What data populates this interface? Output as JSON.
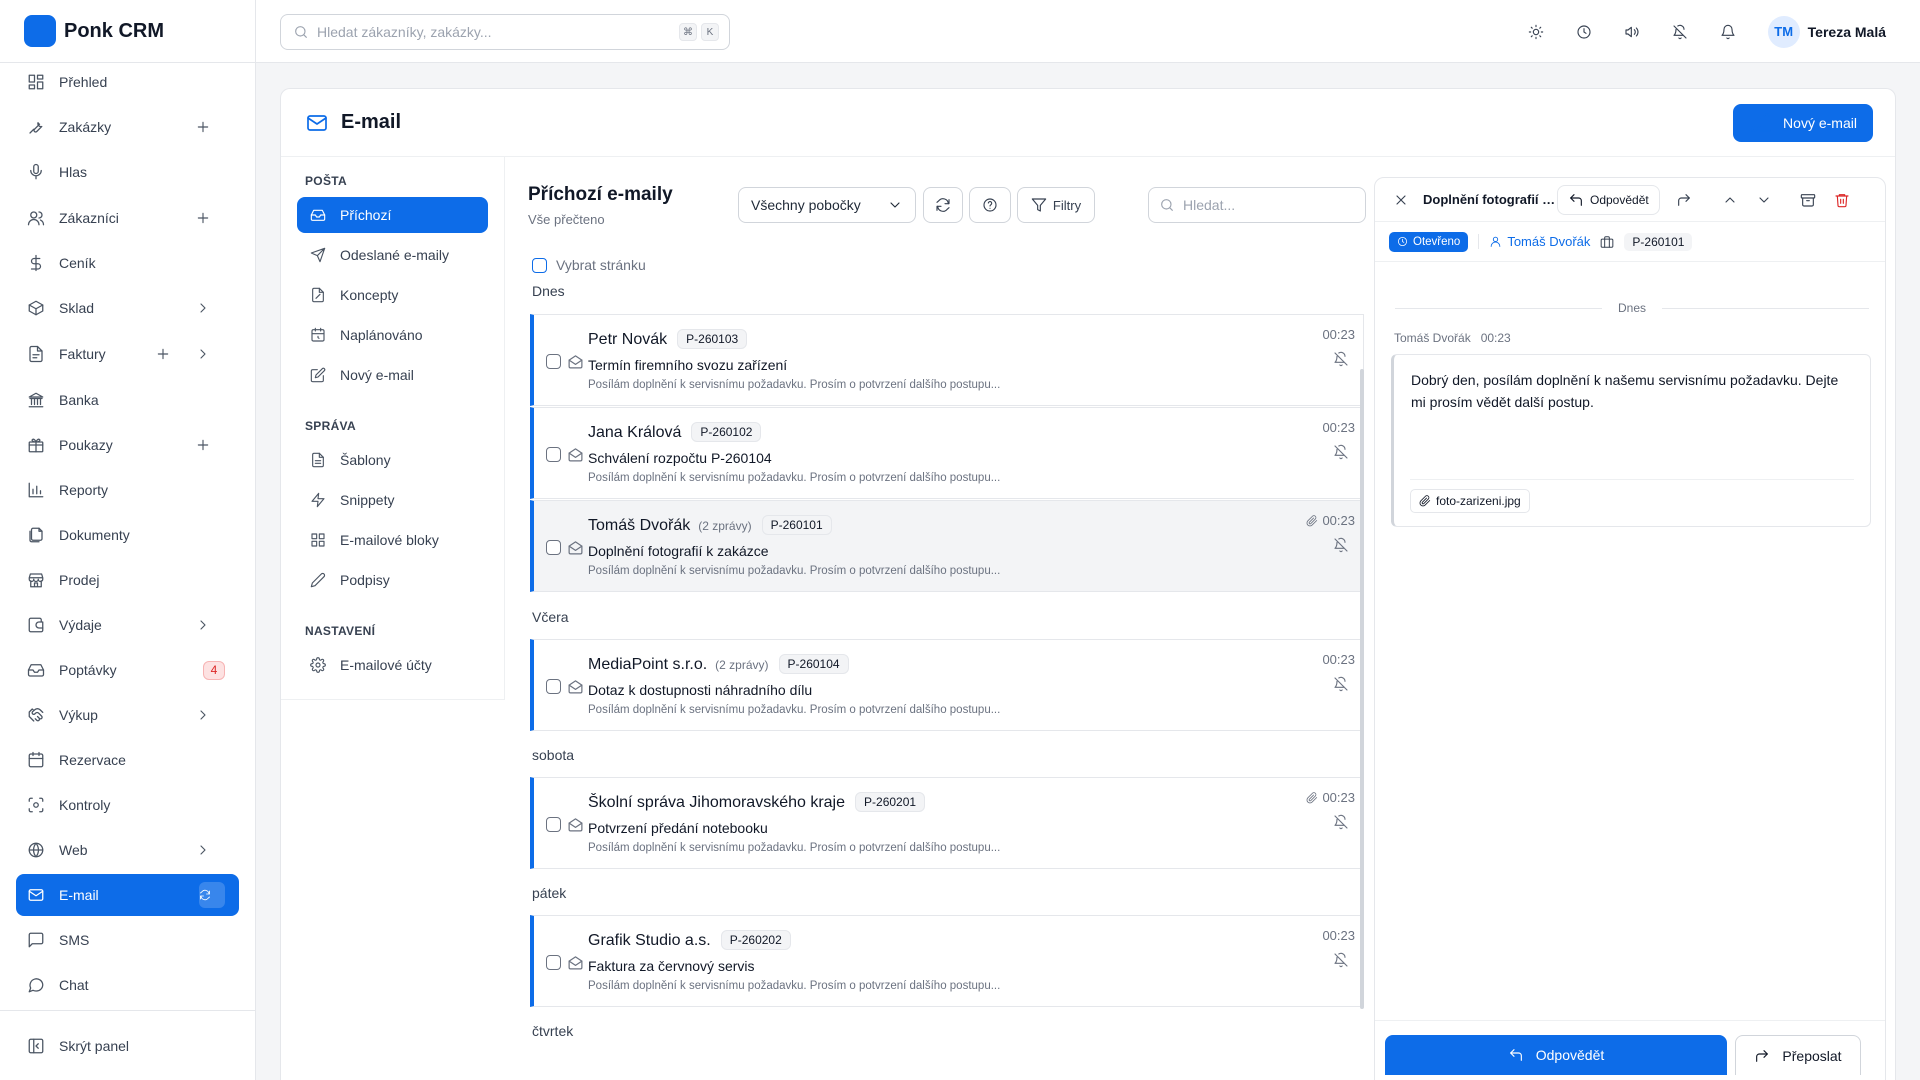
{
  "app": {
    "name": "Ponk CRM"
  },
  "sidebar": {
    "items": [
      {
        "label": "Přehled",
        "icon": "dashboard-icon"
      },
      {
        "label": "Zakázky",
        "icon": "wrench-icon",
        "plus": true
      },
      {
        "label": "Hlas",
        "icon": "microphone-icon"
      },
      {
        "label": "Zákazníci",
        "icon": "users-icon",
        "plus": true
      },
      {
        "label": "Ceník",
        "icon": "dollar-icon"
      },
      {
        "label": "Sklad",
        "icon": "box-icon",
        "chevron": true
      },
      {
        "label": "Faktury",
        "icon": "invoice-icon",
        "plus": true,
        "chevron": true
      },
      {
        "label": "Banka",
        "icon": "bank-icon"
      },
      {
        "label": "Poukazy",
        "icon": "gift-icon",
        "plus": true
      },
      {
        "label": "Reporty",
        "icon": "bar-chart-icon"
      },
      {
        "label": "Dokumenty",
        "icon": "documents-icon"
      },
      {
        "label": "Prodej",
        "icon": "store-icon"
      },
      {
        "label": "Výdaje",
        "icon": "wallet-icon",
        "chevron": true
      },
      {
        "label": "Poptávky",
        "icon": "inbox-icon",
        "badge": "4"
      },
      {
        "label": "Výkup",
        "icon": "handshake-icon",
        "chevron": true
      },
      {
        "label": "Rezervace",
        "icon": "calendar-icon"
      },
      {
        "label": "Kontroly",
        "icon": "scan-icon"
      },
      {
        "label": "Web",
        "icon": "globe-icon",
        "chevron": true
      },
      {
        "label": "E-mail",
        "icon": "mail-icon",
        "active": true
      },
      {
        "label": "SMS",
        "icon": "message-icon"
      },
      {
        "label": "Chat",
        "icon": "chat-icon"
      }
    ],
    "hide_panel": "Skrýt panel"
  },
  "topbar": {
    "search_placeholder": "Hledat zákazníky, zakázky...",
    "shortcut": [
      "⌘",
      "K"
    ],
    "user": {
      "initials": "TM",
      "name": "Tereza Malá"
    }
  },
  "page": {
    "title": "E-mail",
    "new_email": "Nový e-mail"
  },
  "folders": {
    "sections": [
      {
        "title": "POŠTA",
        "items": [
          {
            "label": "Příchozí",
            "icon": "inbox-icon",
            "active": true
          },
          {
            "label": "Odeslané e-maily",
            "icon": "send-icon"
          },
          {
            "label": "Koncepty",
            "icon": "draft-icon"
          },
          {
            "label": "Naplánováno",
            "icon": "calendar-clock-icon"
          },
          {
            "label": "Nový e-mail",
            "icon": "edit-icon"
          }
        ]
      },
      {
        "title": "SPRÁVA",
        "items": [
          {
            "label": "Šablony",
            "icon": "file-text-icon"
          },
          {
            "label": "Snippety",
            "icon": "zap-icon"
          },
          {
            "label": "E-mailové bloky",
            "icon": "grid-icon"
          },
          {
            "label": "Podpisy",
            "icon": "pen-icon"
          }
        ]
      },
      {
        "title": "NASTAVENÍ",
        "items": [
          {
            "label": "E-mailové účty",
            "icon": "gear-icon"
          }
        ]
      }
    ]
  },
  "list": {
    "title": "Příchozí e-maily",
    "subtitle": "Vše přečteno",
    "branch_select": "Všechny pobočky",
    "filters_label": "Filtry",
    "search_placeholder": "Hledat...",
    "select_page": "Vybrat stránku",
    "days": [
      "Dnes",
      "Včera",
      "sobota",
      "pátek",
      "čtvrtek"
    ],
    "emails": [
      {
        "from": "Petr Novák",
        "count": "",
        "tag": "P-260103",
        "subject": "Termín firemního svozu zařízení",
        "preview": "Posílám doplnění k servisnímu požadavku. Prosím o potvrzení dalšího postupu...",
        "time": "00:23",
        "attachment": false
      },
      {
        "from": "Jana Králová",
        "count": "",
        "tag": "P-260102",
        "subject": "Schválení rozpočtu P-260104",
        "preview": "Posílám doplnění k servisnímu požadavku. Prosím o potvrzení dalšího postupu...",
        "time": "00:23",
        "attachment": false
      },
      {
        "from": "Tomáš Dvořák",
        "count": "(2 zprávy)",
        "tag": "P-260101",
        "subject": "Doplnění fotografií k zakázce",
        "preview": "Posílám doplnění k servisnímu požadavku. Prosím o potvrzení dalšího postupu...",
        "time": "00:23",
        "attachment": true
      },
      {
        "from": "MediaPoint s.r.o.",
        "count": "(2 zprávy)",
        "tag": "P-260104",
        "subject": "Dotaz k dostupnosti náhradního dílu",
        "preview": "Posílám doplnění k servisnímu požadavku. Prosím o potvrzení dalšího postupu...",
        "time": "00:23",
        "attachment": false
      },
      {
        "from": "Školní správa Jihomoravského kraje",
        "count": "",
        "tag": "P-260201",
        "subject": "Potvrzení předání notebooku",
        "preview": "Posílám doplnění k servisnímu požadavku. Prosím o potvrzení dalšího postupu...",
        "time": "00:23",
        "attachment": true
      },
      {
        "from": "Grafik Studio a.s.",
        "count": "",
        "tag": "P-260202",
        "subject": "Faktura za červnový servis",
        "preview": "Posílám doplnění k servisnímu požadavku. Prosím o potvrzení dalšího postupu...",
        "time": "00:23",
        "attachment": false
      }
    ]
  },
  "detail": {
    "subject": "Doplnění fotografií k zakázce",
    "reply_label": "Odpovědět",
    "status": "Otevřeno",
    "contact": "Tomáš Dvořák",
    "job": "P-260101",
    "day": "Dnes",
    "sender_line": "Tomáš Dvořák   00:23",
    "body": "Dobrý den, posílám doplnění k našemu servisnímu požadavku. Dejte mi prosím vědět další postup.",
    "attachment": "foto-zarizeni.jpg",
    "footer_reply": "Odpovědět",
    "footer_forward": "Přeposlat"
  },
  "colors": {
    "accent": "#0d6ce8",
    "danger": "#dc2626"
  }
}
